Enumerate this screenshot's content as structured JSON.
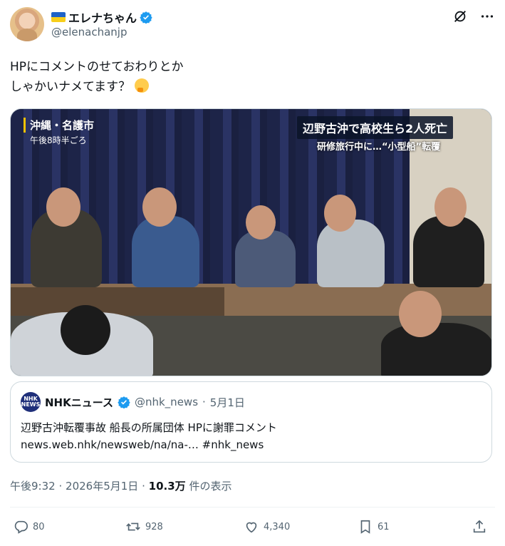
{
  "author": {
    "display_name": "エレナちゃん",
    "handle": "@elenachanjp",
    "verified": true
  },
  "tweet": {
    "text_line1": "HPにコメントのせておわりとか",
    "text_line2": "しゃかいナメてます？"
  },
  "media": {
    "location_label": "沖縄・名護市",
    "time_label": "午後8時半ごろ",
    "headline": "辺野古沖で高校生ら2人死亡",
    "subheadline": "研修旅行中に…“小型船”転覆"
  },
  "quoted": {
    "logo_text": "NHK NEWS",
    "name": "NHKニュース",
    "handle": "@nhk_news",
    "date": "5月1日",
    "text": "辺野古沖転覆事故 船長の所属団体 HPに謝罪コメント",
    "link": "news.web.nhk/newsweb/na/na-…",
    "hashtag": "#nhk_news"
  },
  "meta": {
    "time": "午後9:32",
    "date": "2026年5月1日",
    "views": "10.3万",
    "views_label": "件の表示"
  },
  "actions": {
    "replies": "80",
    "reposts": "928",
    "likes": "4,340",
    "bookmarks": "61"
  },
  "colors": {
    "verified": "#1d9bf0",
    "secondary_text": "#536471",
    "link": "#1d9bf0"
  }
}
